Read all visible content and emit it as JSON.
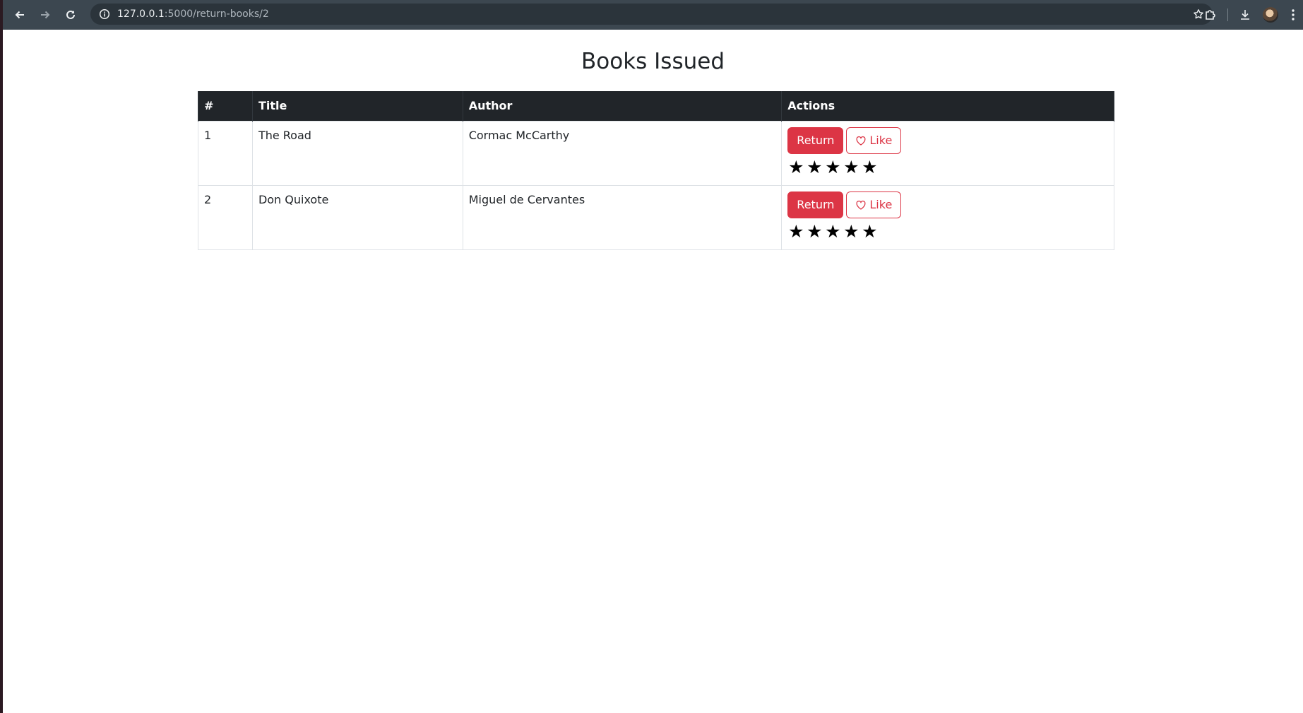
{
  "browser": {
    "url_host": "127.0.0.1",
    "url_path": ":5000/return-books/2"
  },
  "page": {
    "title": "Books Issued"
  },
  "table": {
    "headers": [
      "#",
      "Title",
      "Author",
      "Actions"
    ],
    "rows": [
      {
        "num": "1",
        "title": "The Road",
        "author": "Cormac McCarthy",
        "return_label": "Return",
        "like_label": "Like",
        "rating": 5
      },
      {
        "num": "2",
        "title": "Don Quixote",
        "author": "Miguel de Cervantes",
        "return_label": "Return",
        "like_label": "Like",
        "rating": 5
      }
    ]
  },
  "icons": {
    "back": "arrow-left-icon",
    "forward": "arrow-right-icon",
    "reload": "reload-icon",
    "info": "info-icon",
    "bookmark": "star-outline-icon",
    "extensions": "puzzle-icon",
    "download": "download-icon",
    "menu": "kebab-menu-icon",
    "like": "heart-outline-icon",
    "rating": "star-filled-icon"
  },
  "colors": {
    "danger": "#dc3545",
    "table_header": "#212529",
    "chrome": "#3c4750"
  }
}
